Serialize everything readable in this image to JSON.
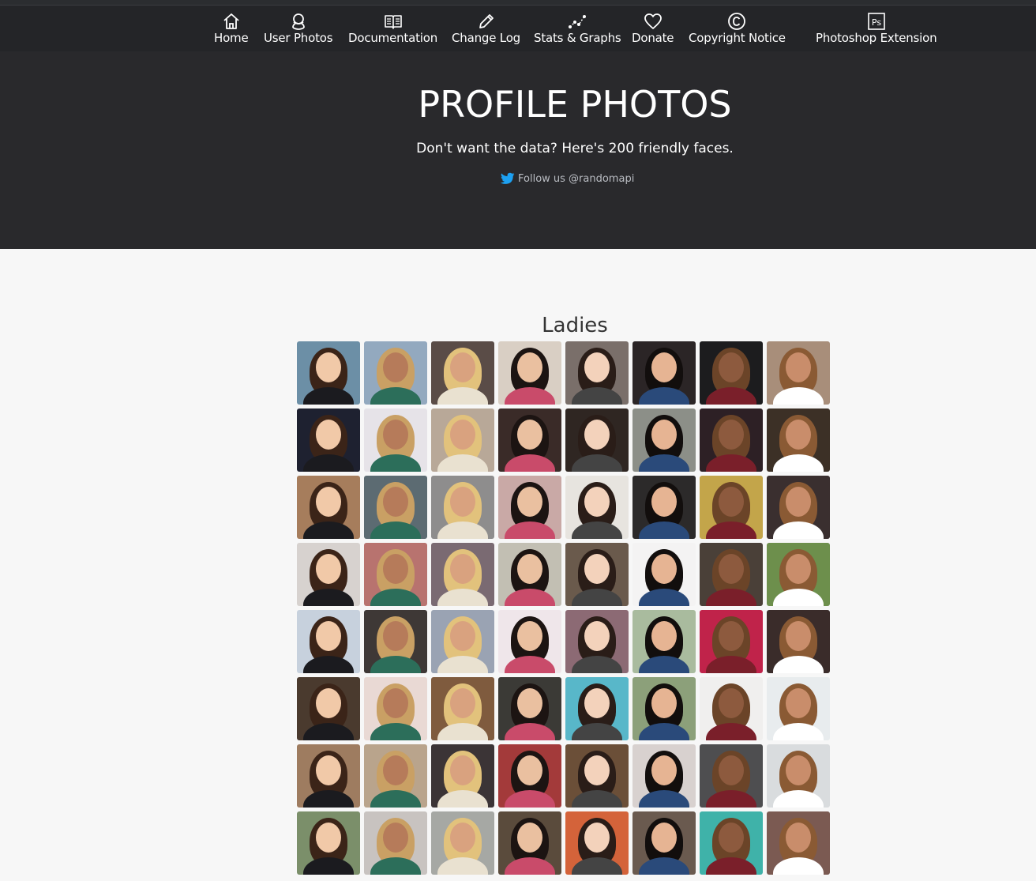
{
  "nav": {
    "items": [
      {
        "label": "Home",
        "icon": "home-icon"
      },
      {
        "label": "User Photos",
        "icon": "user-icon"
      },
      {
        "label": "Documentation",
        "icon": "book-icon"
      },
      {
        "label": "Change Log",
        "icon": "pencil-icon"
      },
      {
        "label": "Stats & Graphs",
        "icon": "graph-icon"
      },
      {
        "label": "Donate",
        "icon": "heart-icon"
      },
      {
        "label": "Copyright Notice",
        "icon": "copyright-icon"
      },
      {
        "label": "Photoshop Extension",
        "icon": "photoshop-icon"
      }
    ]
  },
  "hero": {
    "title": "PROFILE PHOTOS",
    "subtitle": "Don't want the data? Here's 200 friendly faces.",
    "follow": "Follow us @randomapi"
  },
  "section": {
    "title": "Ladies"
  },
  "colors": {
    "nav_bg": "#242528",
    "hero_bg": "#29292c",
    "page_bg": "#f7f7f7",
    "twitter": "#1da1f2"
  }
}
